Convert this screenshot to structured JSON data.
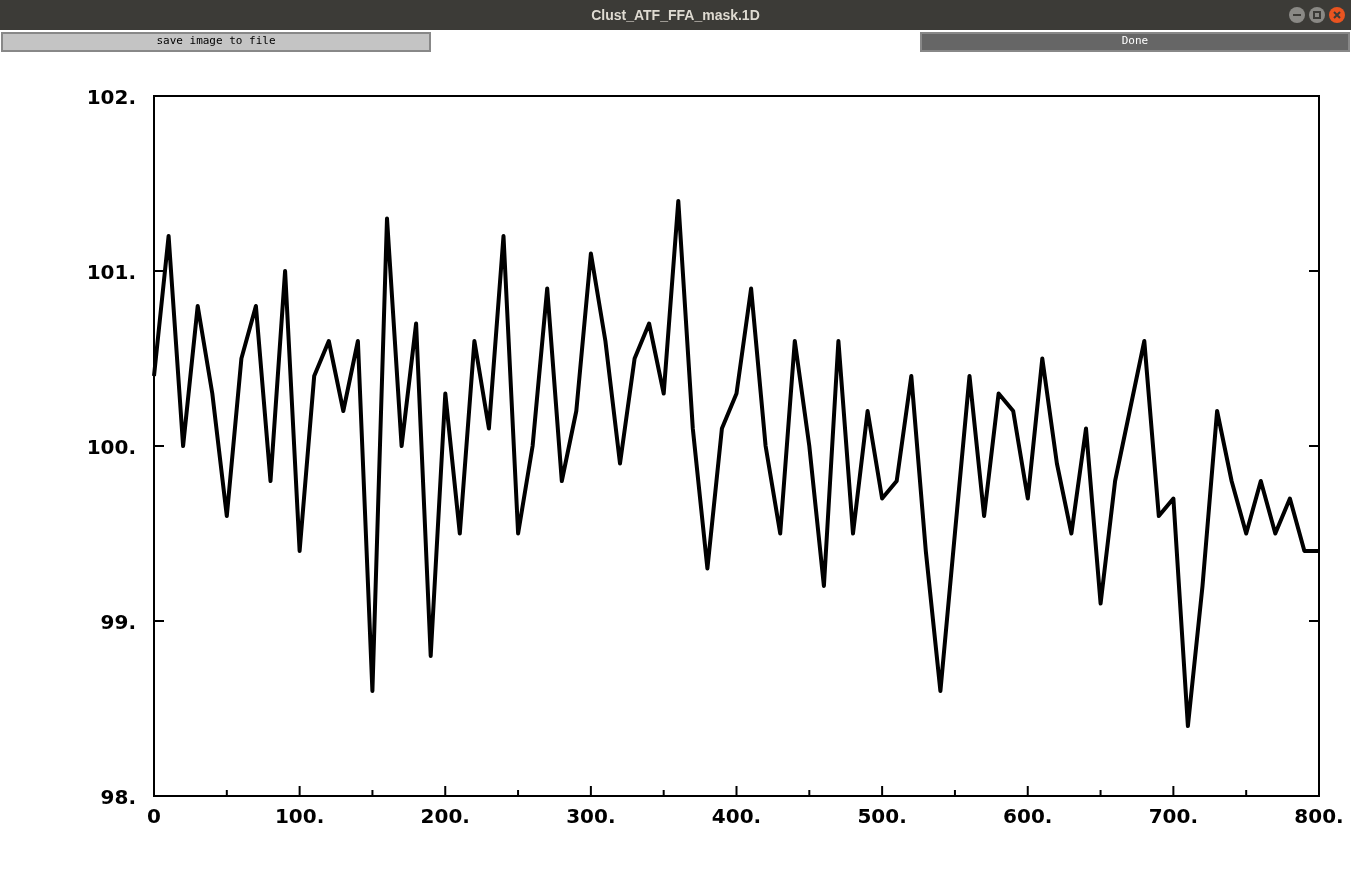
{
  "window": {
    "title": "Clust_ATF_FFA_mask.1D"
  },
  "buttons": [
    {
      "label": "save image to file",
      "kind": "light"
    },
    {
      "label": "Done",
      "kind": "dark"
    }
  ],
  "chart_data": {
    "type": "line",
    "xlim": [
      0,
      800
    ],
    "ylim": [
      98,
      102
    ],
    "xticks": [
      {
        "value": 0,
        "label": "0"
      },
      {
        "value": 100,
        "label": "100."
      },
      {
        "value": 200,
        "label": "200."
      },
      {
        "value": 300,
        "label": "300."
      },
      {
        "value": 400,
        "label": "400."
      },
      {
        "value": 500,
        "label": "500."
      },
      {
        "value": 600,
        "label": "600."
      },
      {
        "value": 700,
        "label": "700."
      },
      {
        "value": 800,
        "label": "800."
      }
    ],
    "yticks": [
      {
        "value": 98,
        "label": "98."
      },
      {
        "value": 99,
        "label": "99."
      },
      {
        "value": 100,
        "label": "100."
      },
      {
        "value": 101,
        "label": "101."
      },
      {
        "value": 102,
        "label": "102."
      }
    ],
    "x": [
      0,
      10,
      20,
      30,
      40,
      50,
      60,
      70,
      80,
      90,
      100,
      110,
      120,
      130,
      140,
      150,
      160,
      170,
      180,
      190,
      200,
      210,
      220,
      230,
      240,
      250,
      260,
      270,
      280,
      290,
      300,
      310,
      320,
      330,
      340,
      350,
      360,
      370,
      380,
      390,
      400,
      410,
      420,
      430,
      440,
      450,
      460,
      470,
      480,
      490,
      500,
      510,
      520,
      530,
      540,
      550,
      560,
      570,
      580,
      590,
      600,
      610,
      620,
      630,
      640,
      650,
      660,
      670,
      680,
      690,
      700,
      710,
      720,
      730,
      740,
      750,
      760,
      770,
      780,
      790,
      800
    ],
    "series": [
      {
        "color": "#000000",
        "values": [
          100.4,
          101.2,
          100.0,
          100.8,
          100.3,
          99.6,
          100.5,
          100.8,
          99.8,
          101.0,
          99.4,
          100.4,
          100.6,
          100.2,
          100.6,
          98.6,
          101.3,
          100.0,
          100.7,
          98.8,
          100.3,
          99.5,
          100.6,
          100.1,
          101.2,
          99.5,
          100.0,
          100.9,
          99.8,
          100.2,
          101.1,
          100.6,
          99.9,
          100.5,
          100.7,
          100.3,
          101.4,
          100.1,
          99.3,
          100.1,
          100.3,
          100.9,
          100.0,
          99.5,
          100.6,
          100.0,
          99.2,
          100.6,
          99.5,
          100.2,
          99.7,
          99.8,
          100.4,
          99.4,
          98.6,
          99.5,
          100.4,
          99.6,
          100.3,
          100.2,
          99.7,
          100.5,
          99.9,
          99.5,
          100.1,
          99.1,
          99.8,
          100.2,
          100.6,
          99.6,
          99.7,
          98.4,
          99.2,
          100.2,
          99.8,
          99.5,
          99.8,
          99.5,
          99.7,
          99.4,
          99.4
        ]
      }
    ]
  }
}
